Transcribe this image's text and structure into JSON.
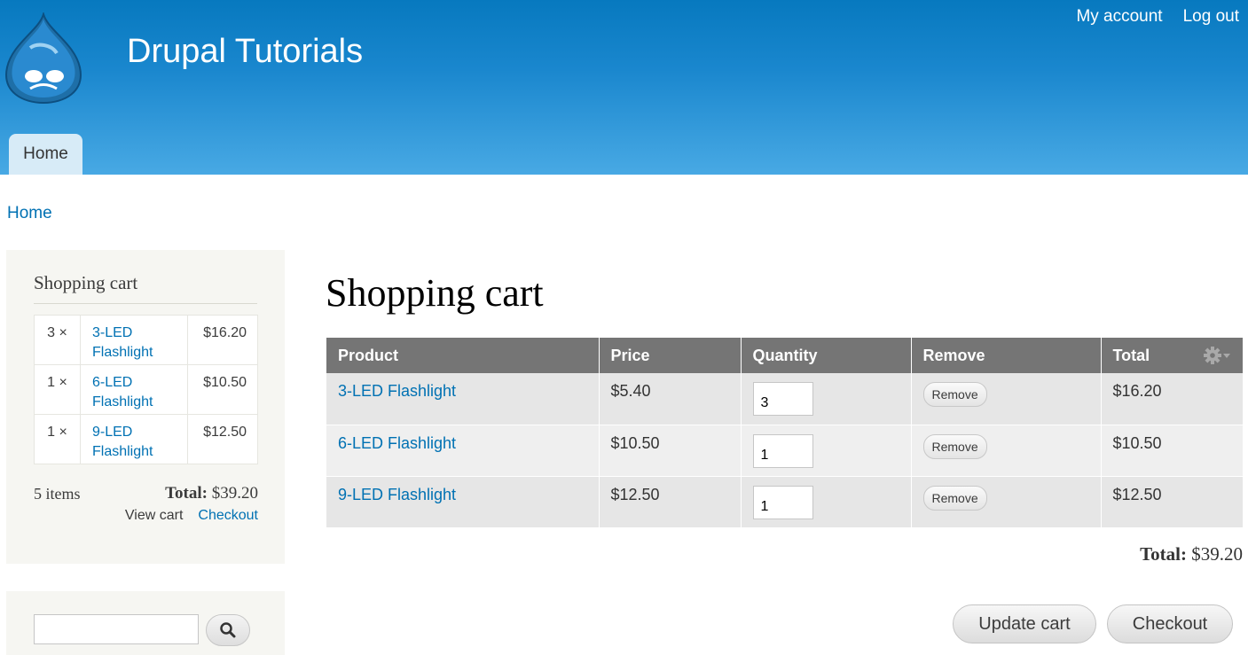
{
  "header": {
    "site_name": "Drupal Tutorials",
    "secondary_menu": [
      "My account",
      "Log out"
    ],
    "main_menu": [
      "Home"
    ]
  },
  "breadcrumb": "Home",
  "sidebar": {
    "cart_block": {
      "title": "Shopping cart",
      "items": [
        {
          "qty": "3 ×",
          "title": "3-LED Flashlight",
          "price": "$16.20"
        },
        {
          "qty": "1 ×",
          "title": "6-LED Flashlight",
          "price": "$10.50"
        },
        {
          "qty": "1 ×",
          "title": "9-LED Flashlight",
          "price": "$12.50"
        }
      ],
      "item_count": "5 items",
      "total_label": "Total:",
      "total_value": "$39.20",
      "view_cart": "View cart",
      "checkout": "Checkout"
    },
    "search": {
      "value": ""
    }
  },
  "main": {
    "title": "Shopping cart",
    "columns": [
      "Product",
      "Price",
      "Quantity",
      "Remove",
      "Total"
    ],
    "rows": [
      {
        "product": "3-LED Flashlight",
        "price": "$5.40",
        "qty": "3",
        "remove": "Remove",
        "total": "$16.20"
      },
      {
        "product": "6-LED Flashlight",
        "price": "$10.50",
        "qty": "1",
        "remove": "Remove",
        "total": "$10.50"
      },
      {
        "product": "9-LED Flashlight",
        "price": "$12.50",
        "qty": "1",
        "remove": "Remove",
        "total": "$12.50"
      }
    ],
    "total_label": "Total:",
    "total_value": "$39.20",
    "update_button": "Update cart",
    "checkout_button": "Checkout"
  }
}
